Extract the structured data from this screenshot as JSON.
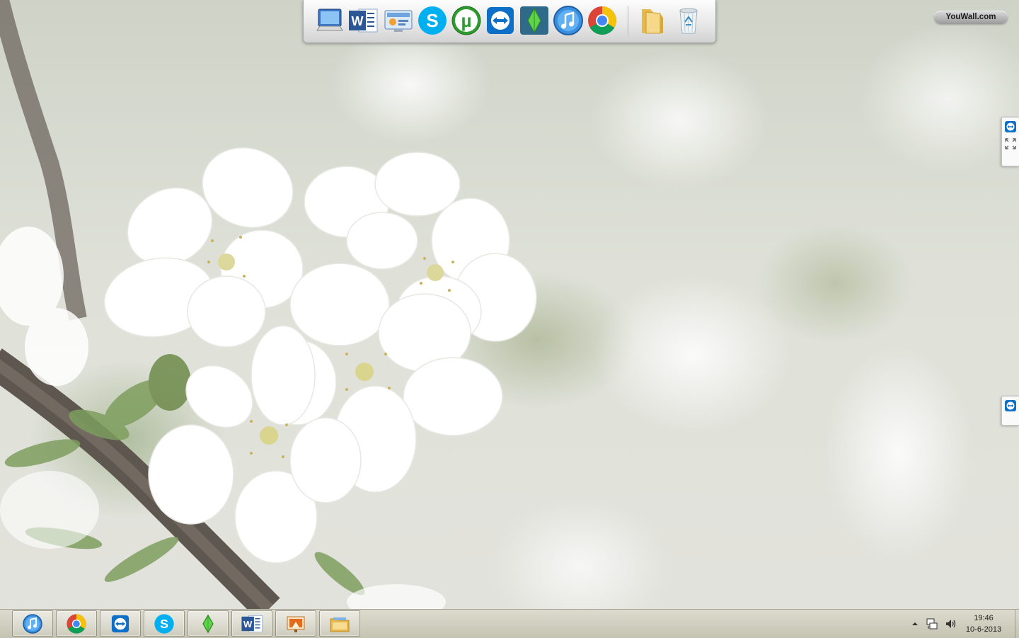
{
  "desktop": {
    "watermark": "YouWall.com"
  },
  "dock": {
    "items": [
      {
        "name": "computer-icon"
      },
      {
        "name": "word-icon",
        "glyph": "W"
      },
      {
        "name": "control-panel-icon"
      },
      {
        "name": "skype-icon",
        "glyph": "S"
      },
      {
        "name": "utorrent-icon",
        "glyph": "µ"
      },
      {
        "name": "teamviewer-icon"
      },
      {
        "name": "sims-icon"
      },
      {
        "name": "itunes-icon"
      },
      {
        "name": "chrome-icon"
      },
      {
        "name": "folder-icon"
      },
      {
        "name": "recycle-bin-icon"
      }
    ]
  },
  "taskbar": {
    "buttons": [
      {
        "name": "itunes-icon"
      },
      {
        "name": "chrome-icon"
      },
      {
        "name": "teamviewer-icon"
      },
      {
        "name": "skype-icon",
        "glyph": "S"
      },
      {
        "name": "sims-icon"
      },
      {
        "name": "word-icon",
        "glyph": "W"
      },
      {
        "name": "slideshow-icon"
      },
      {
        "name": "file-explorer-icon"
      }
    ],
    "tray": {
      "icons": [
        "show-hidden-icons-icon",
        "network-icon",
        "volume-icon"
      ]
    },
    "clock": {
      "time": "19:46",
      "date": "10-6-2013"
    }
  },
  "colors": {
    "skype": "#00aff0",
    "utorrent": "#2e9b2e",
    "word": "#2b5797",
    "teamviewer": "#0e6fc7",
    "chrome_red": "#db4437",
    "chrome_yellow": "#f4c20d",
    "chrome_green": "#0f9d58",
    "chrome_blue": "#4285f4"
  }
}
